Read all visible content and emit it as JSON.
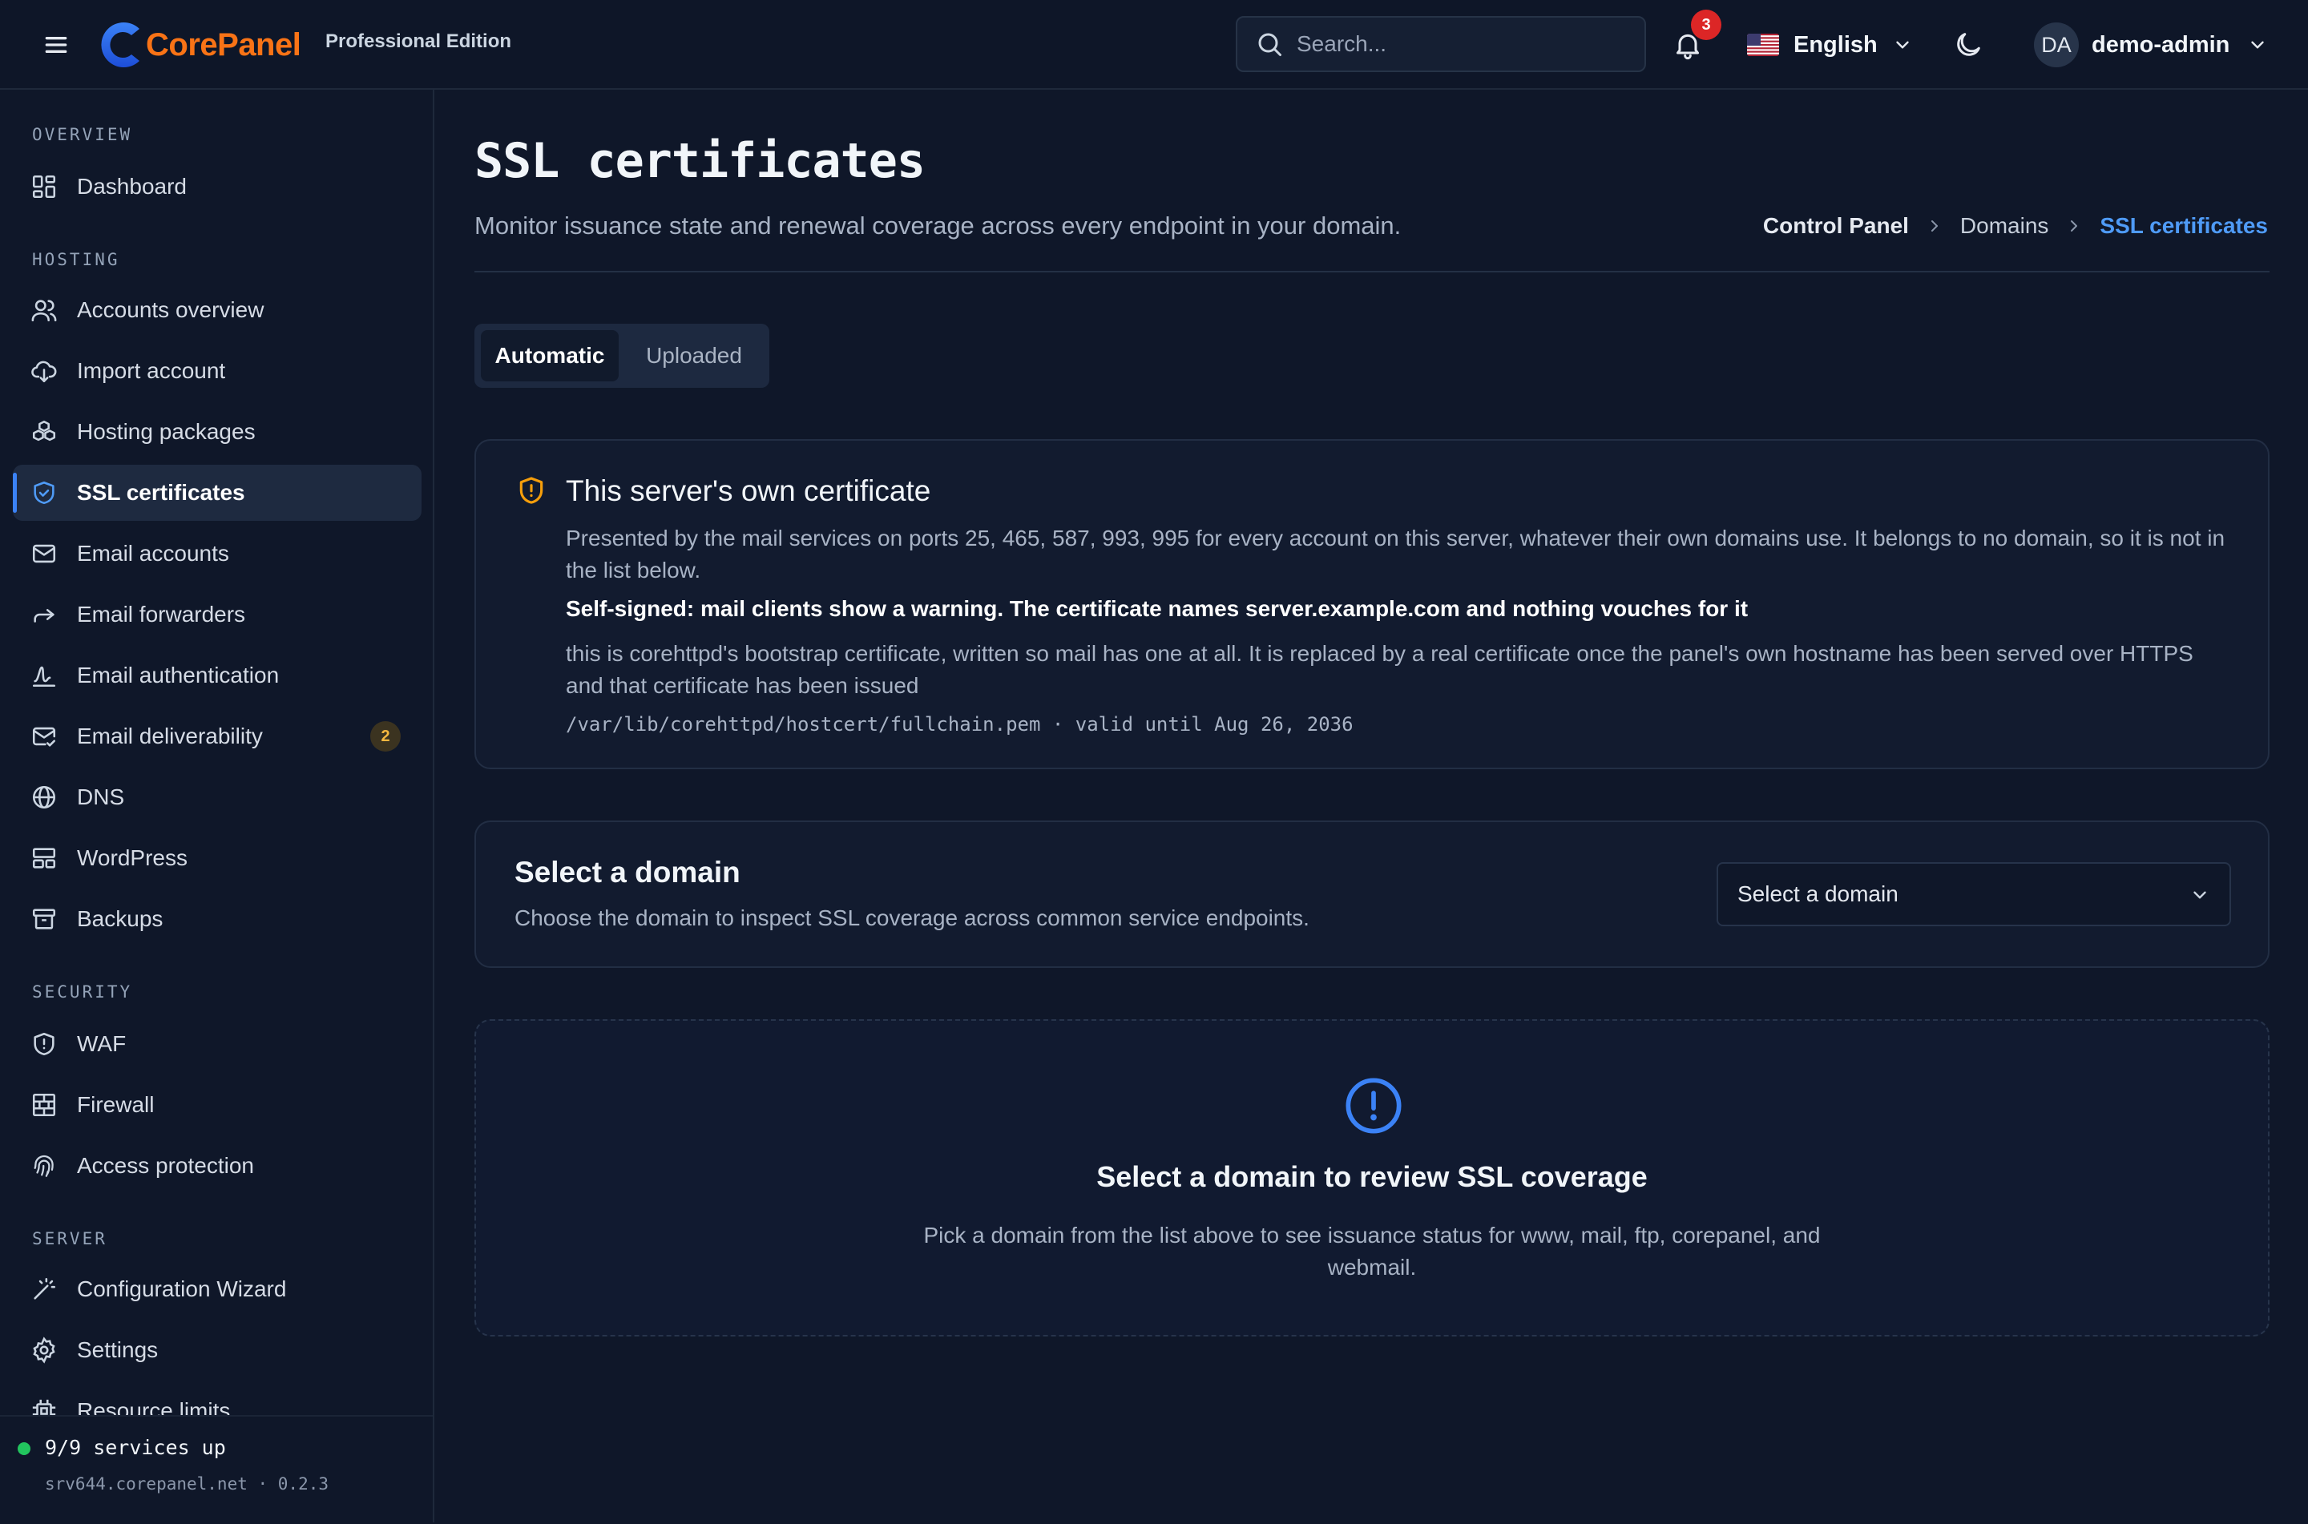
{
  "header": {
    "brand": "CorePanel",
    "edition": "Professional Edition",
    "search_placeholder": "Search...",
    "notification_count": "3",
    "language": "English",
    "user_initials": "DA",
    "user_name": "demo-admin"
  },
  "sidebar": {
    "sections": [
      {
        "title": "OVERVIEW",
        "items": [
          {
            "label": "Dashboard",
            "icon": "dashboard-icon"
          }
        ]
      },
      {
        "title": "HOSTING",
        "items": [
          {
            "label": "Accounts overview",
            "icon": "users-icon"
          },
          {
            "label": "Import account",
            "icon": "cloud-download-icon"
          },
          {
            "label": "Hosting packages",
            "icon": "packages-icon"
          },
          {
            "label": "SSL certificates",
            "icon": "shield-check-icon",
            "active": true
          },
          {
            "label": "Email accounts",
            "icon": "mail-icon"
          },
          {
            "label": "Email forwarders",
            "icon": "forward-icon"
          },
          {
            "label": "Email authentication",
            "icon": "signature-icon"
          },
          {
            "label": "Email deliverability",
            "icon": "mail-check-icon",
            "badge": "2"
          },
          {
            "label": "DNS",
            "icon": "globe-icon"
          },
          {
            "label": "WordPress",
            "icon": "layout-icon"
          },
          {
            "label": "Backups",
            "icon": "archive-icon"
          }
        ]
      },
      {
        "title": "SECURITY",
        "items": [
          {
            "label": "WAF",
            "icon": "shield-alert-icon"
          },
          {
            "label": "Firewall",
            "icon": "brick-wall-icon"
          },
          {
            "label": "Access protection",
            "icon": "fingerprint-icon"
          }
        ]
      },
      {
        "title": "SERVER",
        "items": [
          {
            "label": "Configuration Wizard",
            "icon": "wand-icon"
          },
          {
            "label": "Settings",
            "icon": "gear-icon"
          },
          {
            "label": "Resource limits",
            "icon": "cpu-icon"
          }
        ]
      }
    ],
    "status": "9/9 services up",
    "host": "srv644.corepanel.net · 0.2.3"
  },
  "page": {
    "title": "SSL certificates",
    "subtitle": "Monitor issuance state and renewal coverage across every endpoint in your domain.",
    "breadcrumb": [
      "Control Panel",
      "Domains",
      "SSL certificates"
    ],
    "tabs": [
      "Automatic",
      "Uploaded"
    ]
  },
  "cert_card": {
    "title": "This server's own certificate",
    "description": "Presented by the mail services on ports 25, 465, 587, 993, 995 for every account on this server, whatever their own domains use. It belongs to no domain, so it is not in the list below.",
    "warning": "Self-signed: mail clients show a warning. The certificate names server.example.com and nothing vouches for it",
    "note": "this is corehttpd's bootstrap certificate, written so mail has one at all. It is replaced by a real certificate once the panel's own hostname has been served over HTTPS and that certificate has been issued",
    "path": "/var/lib/corehttpd/hostcert/fullchain.pem · valid until Aug 26, 2036"
  },
  "select_card": {
    "title": "Select a domain",
    "subtitle": "Choose the domain to inspect SSL coverage across common service endpoints.",
    "select_value": "Select a domain"
  },
  "empty_state": {
    "title": "Select a domain to review SSL coverage",
    "subtitle": "Pick a domain from the list above to see issuance status for www, mail, ftp, corepanel, and webmail."
  },
  "colors": {
    "accent": "#3b82f6",
    "brand": "#f97316",
    "warning": "#f59e0b",
    "status_ok": "#22c55e",
    "badge_red": "#dc2626"
  }
}
